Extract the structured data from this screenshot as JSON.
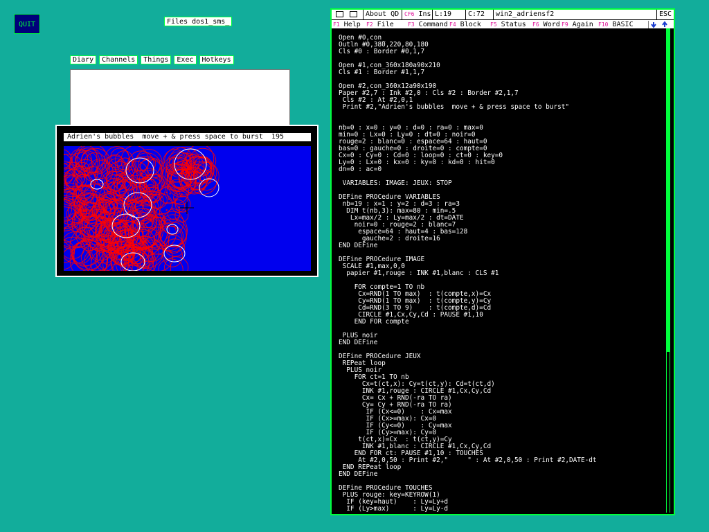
{
  "desktop": {
    "quit_label": "QUIT",
    "files_label": "Files dos1_sms_",
    "tabs": [
      "Diary",
      "Channels",
      "Things",
      "Exec",
      "Hotkeys"
    ]
  },
  "bubbles_window": {
    "title": "Adrien's bubbles  move + & press space to burst  195",
    "colors": {
      "background": "#0000ee",
      "bubble": "#ff0000",
      "highlight": "#ffffff"
    }
  },
  "editor": {
    "toolbar": {
      "about_label": "About QD",
      "insert_key": "CF6",
      "insert_label": "Ins",
      "line": "L:19",
      "column": "C:72",
      "filename": "win2_adriensf2",
      "escape_label": "ESC"
    },
    "function_keys": [
      {
        "key": "F1",
        "label": "Help"
      },
      {
        "key": "F2",
        "label": "File"
      },
      {
        "key": "F3",
        "label": "Command"
      },
      {
        "key": "F4",
        "label": "Block"
      },
      {
        "key": "F5",
        "label": "Status"
      },
      {
        "key": "F6",
        "label": "Word"
      },
      {
        "key": "F9",
        "label": "Again"
      },
      {
        "key": "F10",
        "label": "BASIC"
      }
    ],
    "code": "Open #0,con_\nOutln #0,380,220,80,180\nCls #0 : Border #0,1,7\n\nOpen #1,con_360x180a90x210\nCls #1 : Border #1,1,7\n\nOpen #2,con_360x12a90x190\nPaper #2,7 : Ink #2,0 : Cls #2 : Border #2,1,7\n Cls #2 : At #2,0,1\n Print #2,\"Adrien's bubbles  move + & press space to burst\"\n\n\nnb=0 : x=0 : y=0 : d=0 : ra=0 : max=0\nmin=0 : Lx=0 : Ly=0 : dt=0 : noir=0\nrouge=2 : blanc=0 : espace=64 : haut=0\nbas=0 : gauche=0 : droite=0 : compte=0\nCx=0 : Cy=0 : Cd=0 : loop=0 : ct=0 : key=0\nLy=0 : Lx=0 : kx=0 : ky=0 : kd=0 : hit=0\ndn=0 : ac=0\n\n VARIABLES: IMAGE: JEUX: STOP\n\nDEFine PROCedure VARIABLES\n nb=19 : x=1 : y=2 : d=3 : ra=3\n  DIM t(nb,3): max=80 : min=.5\n   Lx=max/2 : Ly=max/2 : dt=DATE\n    noir=0 : rouge=2 : blanc=7\n     espace=64 : haut=4 : bas=128\n      gauche=2 : droite=16\nEND DEFine\n\nDEFine PROCedure IMAGE\n SCALE #1,max,0,0\n  papier #1,rouge : INK #1,blanc : CLS #1\n\n    FOR compte=1 TO nb\n     Cx=RND(1 TO max)  : t(compte,x)=Cx\n     Cy=RND(1 TO max)  : t(compte,y)=Cy\n     Cd=RND(3 TO 9)    : t(compte,d)=Cd\n     CIRCLE #1,Cx,Cy,Cd : PAUSE #1,10\n    END FOR compte\n\n PLUS noir\nEND DEFine\n\nDEFine PROCedure JEUX\n REPeat loop\n  PLUS noir\n    FOR ct=1 TO nb\n      Cx=t(ct,x): Cy=t(ct,y): Cd=t(ct,d)\n      INK #1,rouge : CIRCLE #1,Cx,Cy,Cd\n      Cx= Cx + RND(-ra TO ra)\n      Cy= Cy + RND(-ra TO ra)\n       IF (Cx<=0)    : Cx=max\n       IF (Cx>=max): Cx=0\n       IF (Cy<=0)    : Cy=max\n       IF (Cy>=max): Cy=0\n     t(ct,x)=Cx  : t(ct,y)=Cy\n      INK #1,blanc : CIRCLE #1,Cx,Cy,Cd\n    END FOR ct: PAUSE #1,10 : TOUCHES\n     At #2,0,50 : Print #2,\"     \" : At #2,0,50 : Print #2,DATE-dt\n END REPeat loop\nEND DEFine\n\nDEFine PROCedure TOUCHES\n PLUS rouge: key=KEYROW(1)\n  IF (key=haut)    : Ly=Ly+d\n  IF (Ly>max)      : Ly=Ly-d"
  }
}
